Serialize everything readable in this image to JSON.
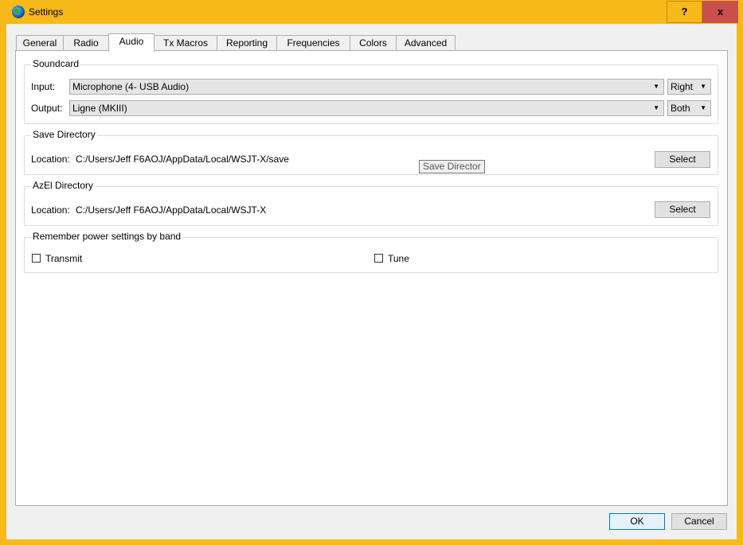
{
  "window": {
    "title": "Settings",
    "help_label": "?",
    "close_label": "x",
    "accent_color": "#f7b81a",
    "close_color": "#c7504f"
  },
  "tabs": [
    {
      "label": "General"
    },
    {
      "label": "Radio"
    },
    {
      "label": "Audio",
      "active": true
    },
    {
      "label": "Tx Macros"
    },
    {
      "label": "Reporting"
    },
    {
      "label": "Frequencies"
    },
    {
      "label": "Colors"
    },
    {
      "label": "Advanced"
    }
  ],
  "soundcard": {
    "title": "Soundcard",
    "input_label": "Input:",
    "input_value": "Microphone (4- USB Audio)",
    "input_channel": "Right",
    "output_label": "Output:",
    "output_value": "Ligne (MKIII)",
    "output_channel": "Both"
  },
  "save_directory": {
    "title": "Save Directory",
    "location_label": "Location:",
    "path": "C:/Users/Jeff F6AOJ/AppData/Local/WSJT-X/save",
    "select_label": "Select"
  },
  "azel_directory": {
    "title": "AzEl Directory",
    "location_label": "Location:",
    "path": "C:/Users/Jeff F6AOJ/AppData/Local/WSJT-X",
    "select_label": "Select"
  },
  "tooltip": {
    "text": "Save Director"
  },
  "power": {
    "title": "Remember power settings by band",
    "transmit_label": "Transmit",
    "transmit_checked": false,
    "tune_label": "Tune",
    "tune_checked": false
  },
  "footer": {
    "ok_label": "OK",
    "cancel_label": "Cancel"
  }
}
